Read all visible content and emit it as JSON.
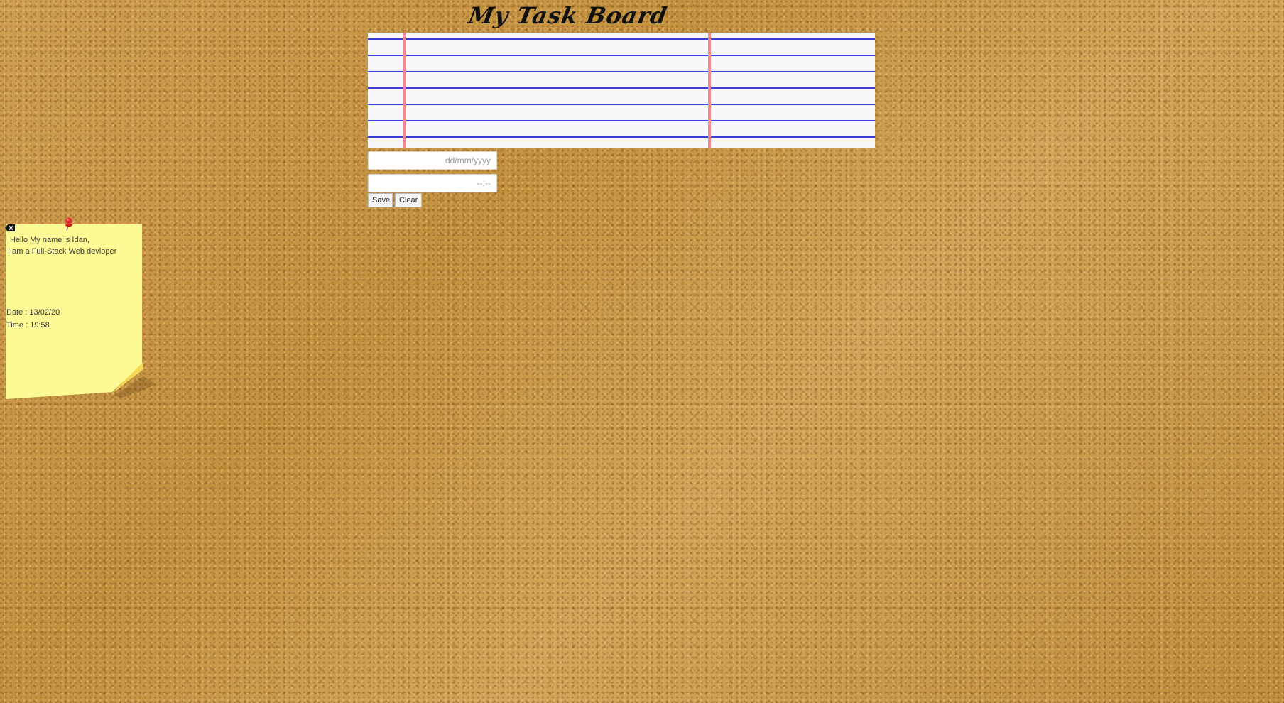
{
  "board": {
    "title": "My Task Board"
  },
  "form": {
    "task_text": "",
    "date_placeholder": "dd/mm/yyyy",
    "time_placeholder": "--:--",
    "save_label": "Save",
    "clear_label": "Clear"
  },
  "notes": [
    {
      "line1": "Hello My name is Idan,",
      "line2": "I am a Full-Stack Web devloper",
      "date": "Date : 13/02/20",
      "time": "Time : 19:58"
    }
  ],
  "icons": {
    "note_close": "delete-backspace-icon",
    "note_pin": "pushpin-icon"
  },
  "colors": {
    "note": "#fdfa95",
    "paper_line": "#3b3bd8",
    "paper_margin": "#ef8a8f",
    "pin": "#e22b2b"
  }
}
